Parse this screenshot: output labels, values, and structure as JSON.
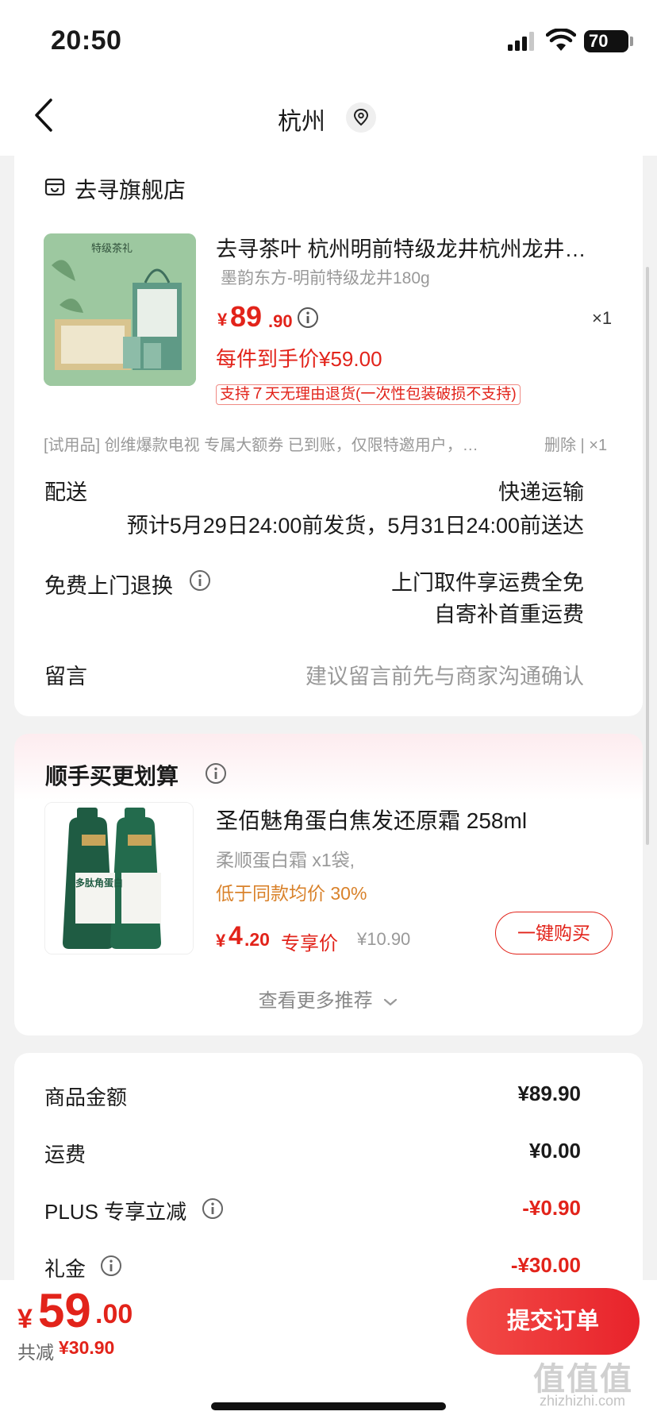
{
  "status_bar": {
    "time": "20:50",
    "battery": "70"
  },
  "nav": {
    "title": "杭州"
  },
  "store": {
    "name": "去寻旗舰店"
  },
  "product": {
    "title": "去寻茶叶 杭州明前特级龙井杭州龙井…",
    "spec": "墨韵东方-明前特级龙井180g",
    "price_symbol": "¥",
    "price_int": "89",
    "price_dec": ".90",
    "quantity": "×1",
    "final_price": "每件到手价¥59.00",
    "return_policy": "支持７天无理由退货(一次性包装破损不支持)",
    "image_text": "特级茶礼"
  },
  "gift": {
    "text": "[试用品] 创维爆款电视 专属大额券 已到账，仅限特邀用户，…",
    "action": "删除 | ×1"
  },
  "delivery": {
    "label": "配送",
    "method": "快递运输",
    "estimate": "预计5月29日24:00前发货，5月31日24:00前送达"
  },
  "free_return": {
    "label": "免费上门退换",
    "line1": "上门取件享运费全免",
    "line2": "自寄补首重运费"
  },
  "message": {
    "label": "留言",
    "placeholder": "建议留言前先与商家沟通确认"
  },
  "upsell": {
    "title": "顺手买更划算",
    "product_title": "圣佰魅角蛋白焦发还原霜 258ml",
    "spec": "柔顺蛋白霜 x1袋,",
    "cheaper": "低于同款均价 30%",
    "price_symbol": "¥",
    "price_int": "4",
    "price_dec": ".20",
    "exclusive": "专享价",
    "original": "¥10.90",
    "buy_button": "一键购买",
    "more": "查看更多推荐",
    "image_text": "多肽角蛋白"
  },
  "summary": {
    "rows": [
      {
        "label": "商品金额",
        "value": "¥89.90"
      },
      {
        "label": "运费",
        "value": "¥0.00"
      },
      {
        "label": "PLUS 专享立减",
        "value": "-¥0.90"
      },
      {
        "label": "礼金",
        "value": "-¥30.00"
      }
    ]
  },
  "bottom": {
    "total_symbol": "¥",
    "total_int": "59",
    "total_dec": ".00",
    "saved_label": "共减",
    "saved_value": "¥30.90",
    "submit": "提交订单"
  },
  "watermark": {
    "logo": "值值值",
    "site": "zhizhizhi.com"
  },
  "colors": {
    "accent": "#e2231a",
    "muted": "#999999",
    "orange": "#d9822b"
  },
  "icons": [
    "back-chevron-icon",
    "location-pin-icon",
    "store-icon",
    "info-icon",
    "chevron-down-icon",
    "signal-icon",
    "wifi-icon",
    "battery-icon"
  ]
}
